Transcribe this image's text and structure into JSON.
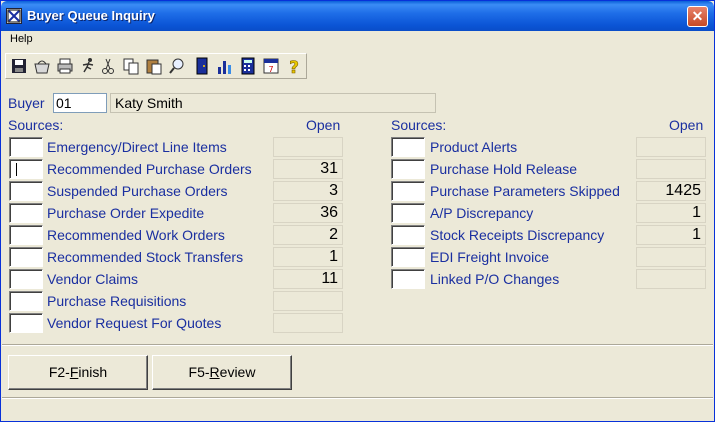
{
  "window": {
    "title": "Buyer Queue Inquiry"
  },
  "menu": {
    "items": [
      "Help"
    ]
  },
  "toolbar": {
    "buttons": [
      "save-icon",
      "basket-icon",
      "printer-icon",
      "run-icon",
      "scissors-icon",
      "copy-icon",
      "paste-icon",
      "find-icon",
      "exit-door-icon",
      "chart-icon",
      "calculator-icon",
      "calendar-icon",
      "help-icon"
    ]
  },
  "buyer": {
    "label": "Buyer",
    "code": "01",
    "name": "Katy Smith"
  },
  "left": {
    "sources_label": "Sources:",
    "open_label": "Open",
    "items": [
      {
        "label": "Emergency/Direct Line Items",
        "count": ""
      },
      {
        "label": "Recommended Purchase Orders",
        "count": "31"
      },
      {
        "label": "Suspended Purchase Orders",
        "count": "3"
      },
      {
        "label": "Purchase Order Expedite",
        "count": "36"
      },
      {
        "label": "Recommended Work Orders",
        "count": "2"
      },
      {
        "label": "Recommended Stock Transfers",
        "count": "1"
      },
      {
        "label": "Vendor Claims",
        "count": "11"
      },
      {
        "label": "Purchase Requisitions",
        "count": ""
      },
      {
        "label": "Vendor Request For Quotes",
        "count": ""
      }
    ]
  },
  "right": {
    "sources_label": "Sources:",
    "open_label": "Open",
    "items": [
      {
        "label": "Product Alerts",
        "count": ""
      },
      {
        "label": "Purchase Hold Release",
        "count": ""
      },
      {
        "label": "Purchase Parameters Skipped",
        "count": "1425"
      },
      {
        "label": "A/P Discrepancy",
        "count": "1"
      },
      {
        "label": "Stock Receipts Discrepancy",
        "count": "1"
      },
      {
        "label": "EDI Freight Invoice",
        "count": ""
      },
      {
        "label": "Linked P/O Changes",
        "count": ""
      }
    ]
  },
  "buttons": {
    "finish": {
      "prefix": "F2-",
      "mnemonic": "F",
      "rest": "inish"
    },
    "review": {
      "prefix": "F5-",
      "mnemonic": "R",
      "rest": "eview"
    }
  }
}
